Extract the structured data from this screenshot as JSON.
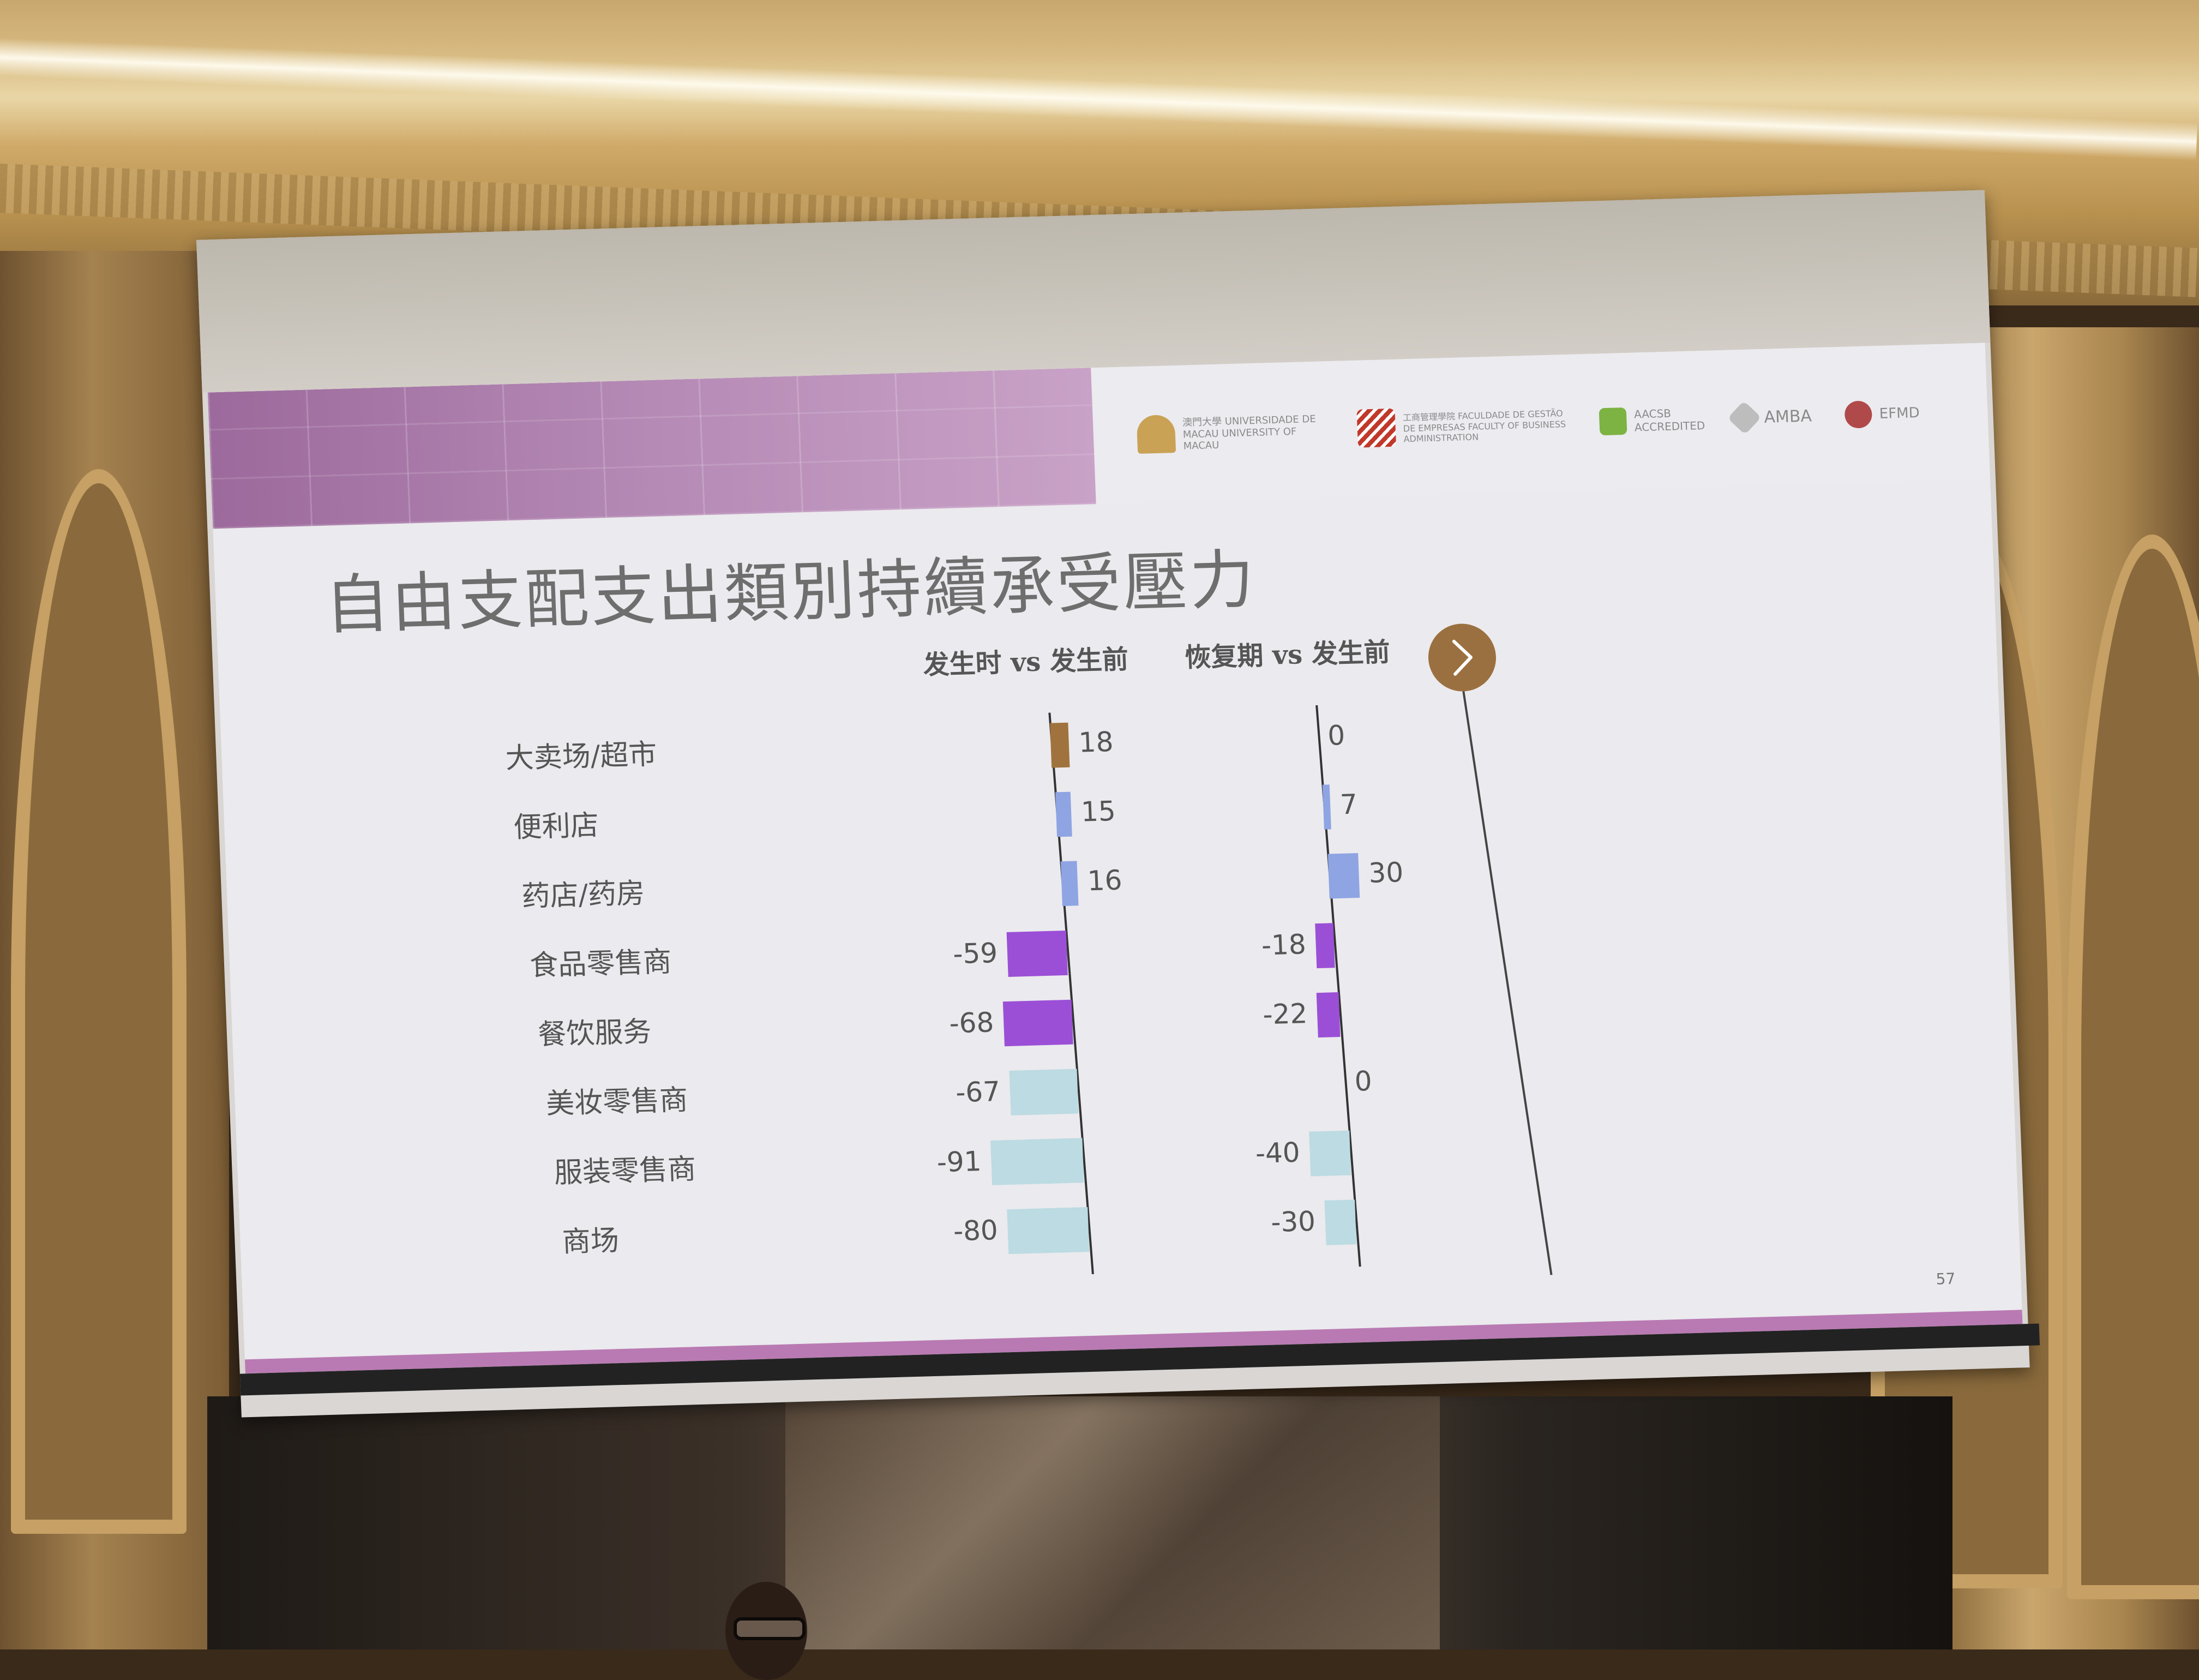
{
  "slide": {
    "title": "自由支配支出類別持續承受壓力",
    "page_number": "57",
    "logos": [
      {
        "name": "university-of-macau-logo",
        "text": "澳門大學 UNIVERSIDADE DE MACAU UNIVERSITY OF MACAU",
        "color": "#c9a255"
      },
      {
        "name": "faculty-business-administration-logo",
        "text": "工商管理學院 FACULDADE DE GESTÃO DE EMPRESAS FACULTY OF BUSINESS ADMINISTRATION",
        "color": "#c0392b"
      },
      {
        "name": "aacsb-logo",
        "text": "AACSB ACCREDITED",
        "color": "#7cb342"
      },
      {
        "name": "amba-logo",
        "text": "AMBA",
        "color": "#9e9e9e"
      },
      {
        "name": "epas-logo",
        "text": "EFMD",
        "color": "#b04a4a"
      }
    ],
    "colors": {
      "header_purple": "#a877a8",
      "brown": "#a0733e",
      "blue": "#8ea4e3",
      "purple": "#9b4fd6",
      "teal": "#bcdbe2",
      "arrow_circle": "#9b7040"
    }
  },
  "chart_data": {
    "type": "bar",
    "orientation": "horizontal",
    "categories": [
      "大卖场/超市",
      "便利店",
      "药店/药房",
      "食品零售商",
      "餐饮服务",
      "美妆零售商",
      "服装零售商",
      "商场"
    ],
    "series": [
      {
        "name": "发生时 vs 发生前",
        "values": [
          18,
          15,
          16,
          -59,
          -68,
          -67,
          -91,
          -80
        ],
        "colors": [
          "#a0733e",
          "#8ea4e3",
          "#8ea4e3",
          "#9b4fd6",
          "#9b4fd6",
          "#bcdbe2",
          "#bcdbe2",
          "#bcdbe2"
        ]
      },
      {
        "name": "恢复期 vs 发生前",
        "values": [
          0,
          7,
          30,
          -18,
          -22,
          0,
          -40,
          -30
        ],
        "colors": [
          "#a0733e",
          "#8ea4e3",
          "#8ea4e3",
          "#9b4fd6",
          "#9b4fd6",
          "#bcdbe2",
          "#bcdbe2",
          "#bcdbe2"
        ]
      }
    ],
    "arrow_icon": "chevron-right-icon"
  }
}
